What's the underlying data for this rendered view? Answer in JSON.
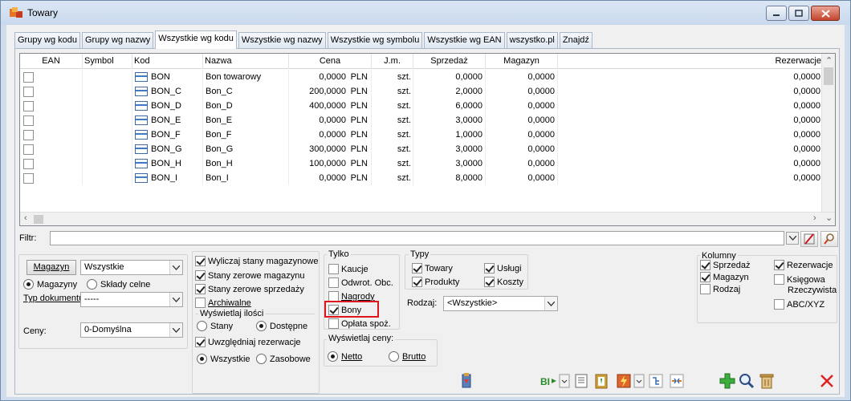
{
  "window": {
    "title": "Towary"
  },
  "tabs": [
    {
      "label": "Grupy wg kodu"
    },
    {
      "label": "Grupy wg nazwy"
    },
    {
      "label": "Wszystkie wg kodu"
    },
    {
      "label": "Wszystkie wg nazwy"
    },
    {
      "label": "Wszystkie wg symbolu"
    },
    {
      "label": "Wszystkie wg EAN"
    },
    {
      "label": "wszystko.pl"
    },
    {
      "label": "Znajdź"
    }
  ],
  "active_tab": 2,
  "grid": {
    "columns": [
      "EAN",
      "Symbol",
      "Kod",
      "Nazwa",
      "Cena",
      "J.m.",
      "Sprzedaż",
      "Magazyn",
      "Rezerwacje"
    ],
    "rows": [
      {
        "kod": "BON",
        "nazwa": "Bon towarowy",
        "cena": "0,0000",
        "waluta": "PLN",
        "jm": "szt.",
        "sprzedaz": "0,0000",
        "magazyn": "0,0000",
        "rezerwacje": "0,0000"
      },
      {
        "kod": "BON_C",
        "nazwa": "Bon_C",
        "cena": "200,0000",
        "waluta": "PLN",
        "jm": "szt.",
        "sprzedaz": "2,0000",
        "magazyn": "0,0000",
        "rezerwacje": "0,0000"
      },
      {
        "kod": "BON_D",
        "nazwa": "Bon_D",
        "cena": "400,0000",
        "waluta": "PLN",
        "jm": "szt.",
        "sprzedaz": "6,0000",
        "magazyn": "0,0000",
        "rezerwacje": "0,0000"
      },
      {
        "kod": "BON_E",
        "nazwa": "Bon_E",
        "cena": "0,0000",
        "waluta": "PLN",
        "jm": "szt.",
        "sprzedaz": "3,0000",
        "magazyn": "0,0000",
        "rezerwacje": "0,0000"
      },
      {
        "kod": "BON_F",
        "nazwa": "Bon_F",
        "cena": "0,0000",
        "waluta": "PLN",
        "jm": "szt.",
        "sprzedaz": "1,0000",
        "magazyn": "0,0000",
        "rezerwacje": "0,0000"
      },
      {
        "kod": "BON_G",
        "nazwa": "Bon_G",
        "cena": "300,0000",
        "waluta": "PLN",
        "jm": "szt.",
        "sprzedaz": "3,0000",
        "magazyn": "0,0000",
        "rezerwacje": "0,0000"
      },
      {
        "kod": "BON_H",
        "nazwa": "Bon_H",
        "cena": "100,0000",
        "waluta": "PLN",
        "jm": "szt.",
        "sprzedaz": "3,0000",
        "magazyn": "0,0000",
        "rezerwacje": "0,0000"
      },
      {
        "kod": "BON_I",
        "nazwa": "Bon_I",
        "cena": "0,0000",
        "waluta": "PLN",
        "jm": "szt.",
        "sprzedaz": "8,0000",
        "magazyn": "0,0000",
        "rezerwacje": "0,0000"
      }
    ]
  },
  "filter": {
    "label": "Filtr:",
    "value": ""
  },
  "left": {
    "magazyn_button": "Magazyn",
    "magazyn_value": "Wszystkie",
    "radio_magazyny": "Magazyny",
    "radio_sklady": "Składy celne",
    "typ_label": "Typ dokumentu:",
    "typ_value": "-----",
    "ceny_label": "Ceny:",
    "ceny_value": "0-Domyślna"
  },
  "options": {
    "wyliczaj": "Wyliczaj stany magazynowe",
    "zerowe_mag": "Stany zerowe magazynu",
    "zerowe_sprz": "Stany zerowe sprzedaży",
    "archiwalne": "Archiwalne",
    "wyswietlaj_ilosci": "Wyświetlaj ilości",
    "stany": "Stany",
    "dostepne": "Dostępne",
    "uwzgledniaj": "Uwzględniaj rezerwacje",
    "wszystkie": "Wszystkie",
    "zasobowe": "Zasobowe"
  },
  "tylko": {
    "title": "Tylko",
    "kaucje": "Kaucje",
    "odwrot": "Odwrot. Obc.",
    "nagrody": "Nagrody",
    "bony": "Bony",
    "oplata": "Opłata spoż."
  },
  "ceny_display": {
    "title": "Wyświetlaj ceny:",
    "netto": "Netto",
    "brutto": "Brutto"
  },
  "typy": {
    "title": "Typy",
    "towary": "Towary",
    "uslugi": "Usługi",
    "produkty": "Produkty",
    "koszty": "Koszty",
    "rodzaj_label": "Rodzaj:",
    "rodzaj_value": "<Wszystkie>"
  },
  "kolumny": {
    "title": "Kolumny",
    "sprzedaz": "Sprzedaż",
    "magazyn": "Magazyn",
    "rodzaj": "Rodzaj",
    "rezerwacje": "Rezerwacje",
    "ksiegowa": "Księgowa",
    "rzeczywista": "Rzeczywista",
    "abc": "ABC/XYZ"
  },
  "colors": {
    "highlight": "#e0141c",
    "window_frame": "#cfdcec"
  }
}
